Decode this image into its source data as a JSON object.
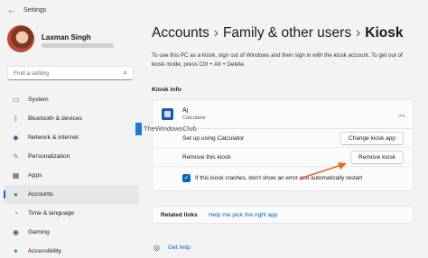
{
  "window": {
    "title": "Settings",
    "back_glyph": "←"
  },
  "profile": {
    "name": "Laxman Singh"
  },
  "search": {
    "placeholder": "Find a setting",
    "icon": "search-icon"
  },
  "sidebar": {
    "items": [
      {
        "label": "System",
        "icon": "monitor-icon",
        "color": "#0078d4"
      },
      {
        "label": "Bluetooth & devices",
        "icon": "bluetooth-icon",
        "color": "#0078d4"
      },
      {
        "label": "Network & internet",
        "icon": "wifi-icon",
        "color": "#2b6cb0"
      },
      {
        "label": "Personalization",
        "icon": "brush-icon",
        "color": "#c26b1a"
      },
      {
        "label": "Apps",
        "icon": "apps-icon",
        "color": "#555555"
      },
      {
        "label": "Accounts",
        "icon": "person-icon",
        "color": "#2e9e4f",
        "active": true
      },
      {
        "label": "Time & language",
        "icon": "clock-globe-icon",
        "color": "#1f7ac2"
      },
      {
        "label": "Gaming",
        "icon": "gamepad-icon",
        "color": "#555555"
      },
      {
        "label": "Accessibility",
        "icon": "accessibility-icon",
        "color": "#1f7ac2"
      }
    ]
  },
  "breadcrumb": {
    "part1": "Accounts",
    "part2": "Family & other users",
    "current": "Kiosk",
    "separator": "›"
  },
  "intro": {
    "text": "To use this PC as a kiosk, sign out of Windows and then sign in with the kiosk account. To get out of kiosk mode, press Ctrl + Alt + Delete."
  },
  "kiosk_info": {
    "section_title": "Kiosk info",
    "account_name": "Aj",
    "account_app": "Calculator",
    "setup_label": "Set up using Calculator",
    "change_button": "Change kiosk app",
    "remove_label": "Remove this kiosk",
    "remove_button": "Remove kiosk",
    "crash_checkbox_label": "If this kiosk crashes, don't show an error and automatically restart",
    "crash_checkbox_checked": true
  },
  "related": {
    "title": "Related links",
    "link": "Help me pick the right app"
  },
  "help": {
    "label": "Get help"
  },
  "watermark": {
    "text": "TheWindowsClub"
  },
  "colors": {
    "accent": "#0067c0",
    "arrow": "#e8662a"
  }
}
